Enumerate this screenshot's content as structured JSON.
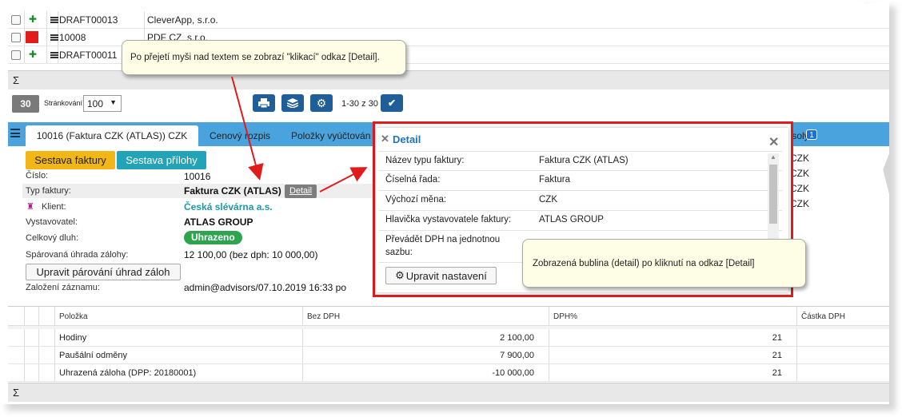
{
  "top_rows": [
    {
      "code": "DRAFT00013",
      "company": "CleverApp, s.r.o.",
      "marker": "pin"
    },
    {
      "code": "10008",
      "company": "PDF CZ, s.r.o.",
      "marker": "red"
    },
    {
      "code": "DRAFT00011",
      "company": "",
      "marker": "pin"
    }
  ],
  "sigma": "Σ",
  "toolbar": {
    "count": "30",
    "paging_label": "Stránkování:",
    "page_size": "100",
    "range": "1-30 z 30"
  },
  "tabs": [
    "10016 (Faktura CZK (ATLAS)) CZK",
    "Cenový rozpis",
    "Položky vyúčtován",
    "soly"
  ],
  "tab_badge": "1",
  "buttons": {
    "report_invoice": "Sestava faktury",
    "report_attachments": "Sestava přílohy",
    "edit_pairing": "Upravit párování úhrad záloh",
    "detail_link": "Detail"
  },
  "form": [
    {
      "label": "Číslo:",
      "value": "10016"
    },
    {
      "label": "Typ faktury:",
      "value": "Faktura CZK (ATLAS)"
    },
    {
      "label": "Klient:",
      "value": "Česká slévárna a.s."
    },
    {
      "label": "Vystavovatel:",
      "value": "ATLAS GROUP"
    },
    {
      "label": "Celkový dluh:",
      "value": "Uhrazeno"
    },
    {
      "label": "Spárovaná úhrada zálohy:",
      "value": "12 100,00 (bez dph: 10 000,00)"
    },
    {
      "label": "Založení záznamu:",
      "value": "admin@advisors/07.10.2019 16:33 po"
    }
  ],
  "right_col": [
    "CZK",
    "CZK",
    "CZK",
    "CZK"
  ],
  "detail": {
    "title": "Detail",
    "rows": [
      {
        "k": "Název typu faktury:",
        "v": "Faktura CZK (ATLAS)"
      },
      {
        "k": "Číselná řada:",
        "v": "Faktura"
      },
      {
        "k": "Výchozí měna:",
        "v": "CZK"
      },
      {
        "k": "Hlavička vystavovatele faktury:",
        "v": "ATLAS GROUP"
      },
      {
        "k": "Převádět DPH na jednotnou",
        "k2": "sazbu:",
        "v": ""
      }
    ],
    "settings_button": "Upravit nastavení"
  },
  "notes": {
    "hover": "Po přejetí myši nad textem se zobrazí \"klikací\" odkaz [Detail].",
    "bubble": "Zobrazená bublina (detail) po kliknutí na odkaz [Detail]"
  },
  "grid": {
    "headers": [
      "Položka",
      "Bez DPH",
      "DPH%",
      "Částka DPH"
    ],
    "rows": [
      {
        "item": "Hodiny",
        "net": "2 100,00",
        "vat": "21"
      },
      {
        "item": "Paušální odměny",
        "net": "7 900,00",
        "vat": "21"
      },
      {
        "item": "Uhrazená záloha (DPP: 20180001)",
        "net": "-10 000,00",
        "vat": "21"
      }
    ]
  },
  "colors": {
    "tab_blue": "#4aa3dc",
    "btn_yellow": "#f3b617",
    "btn_teal": "#22a3b8",
    "link_teal": "#1b9aa8",
    "green_badge": "#2ea44f",
    "highlight_red": "#e01b1b"
  }
}
